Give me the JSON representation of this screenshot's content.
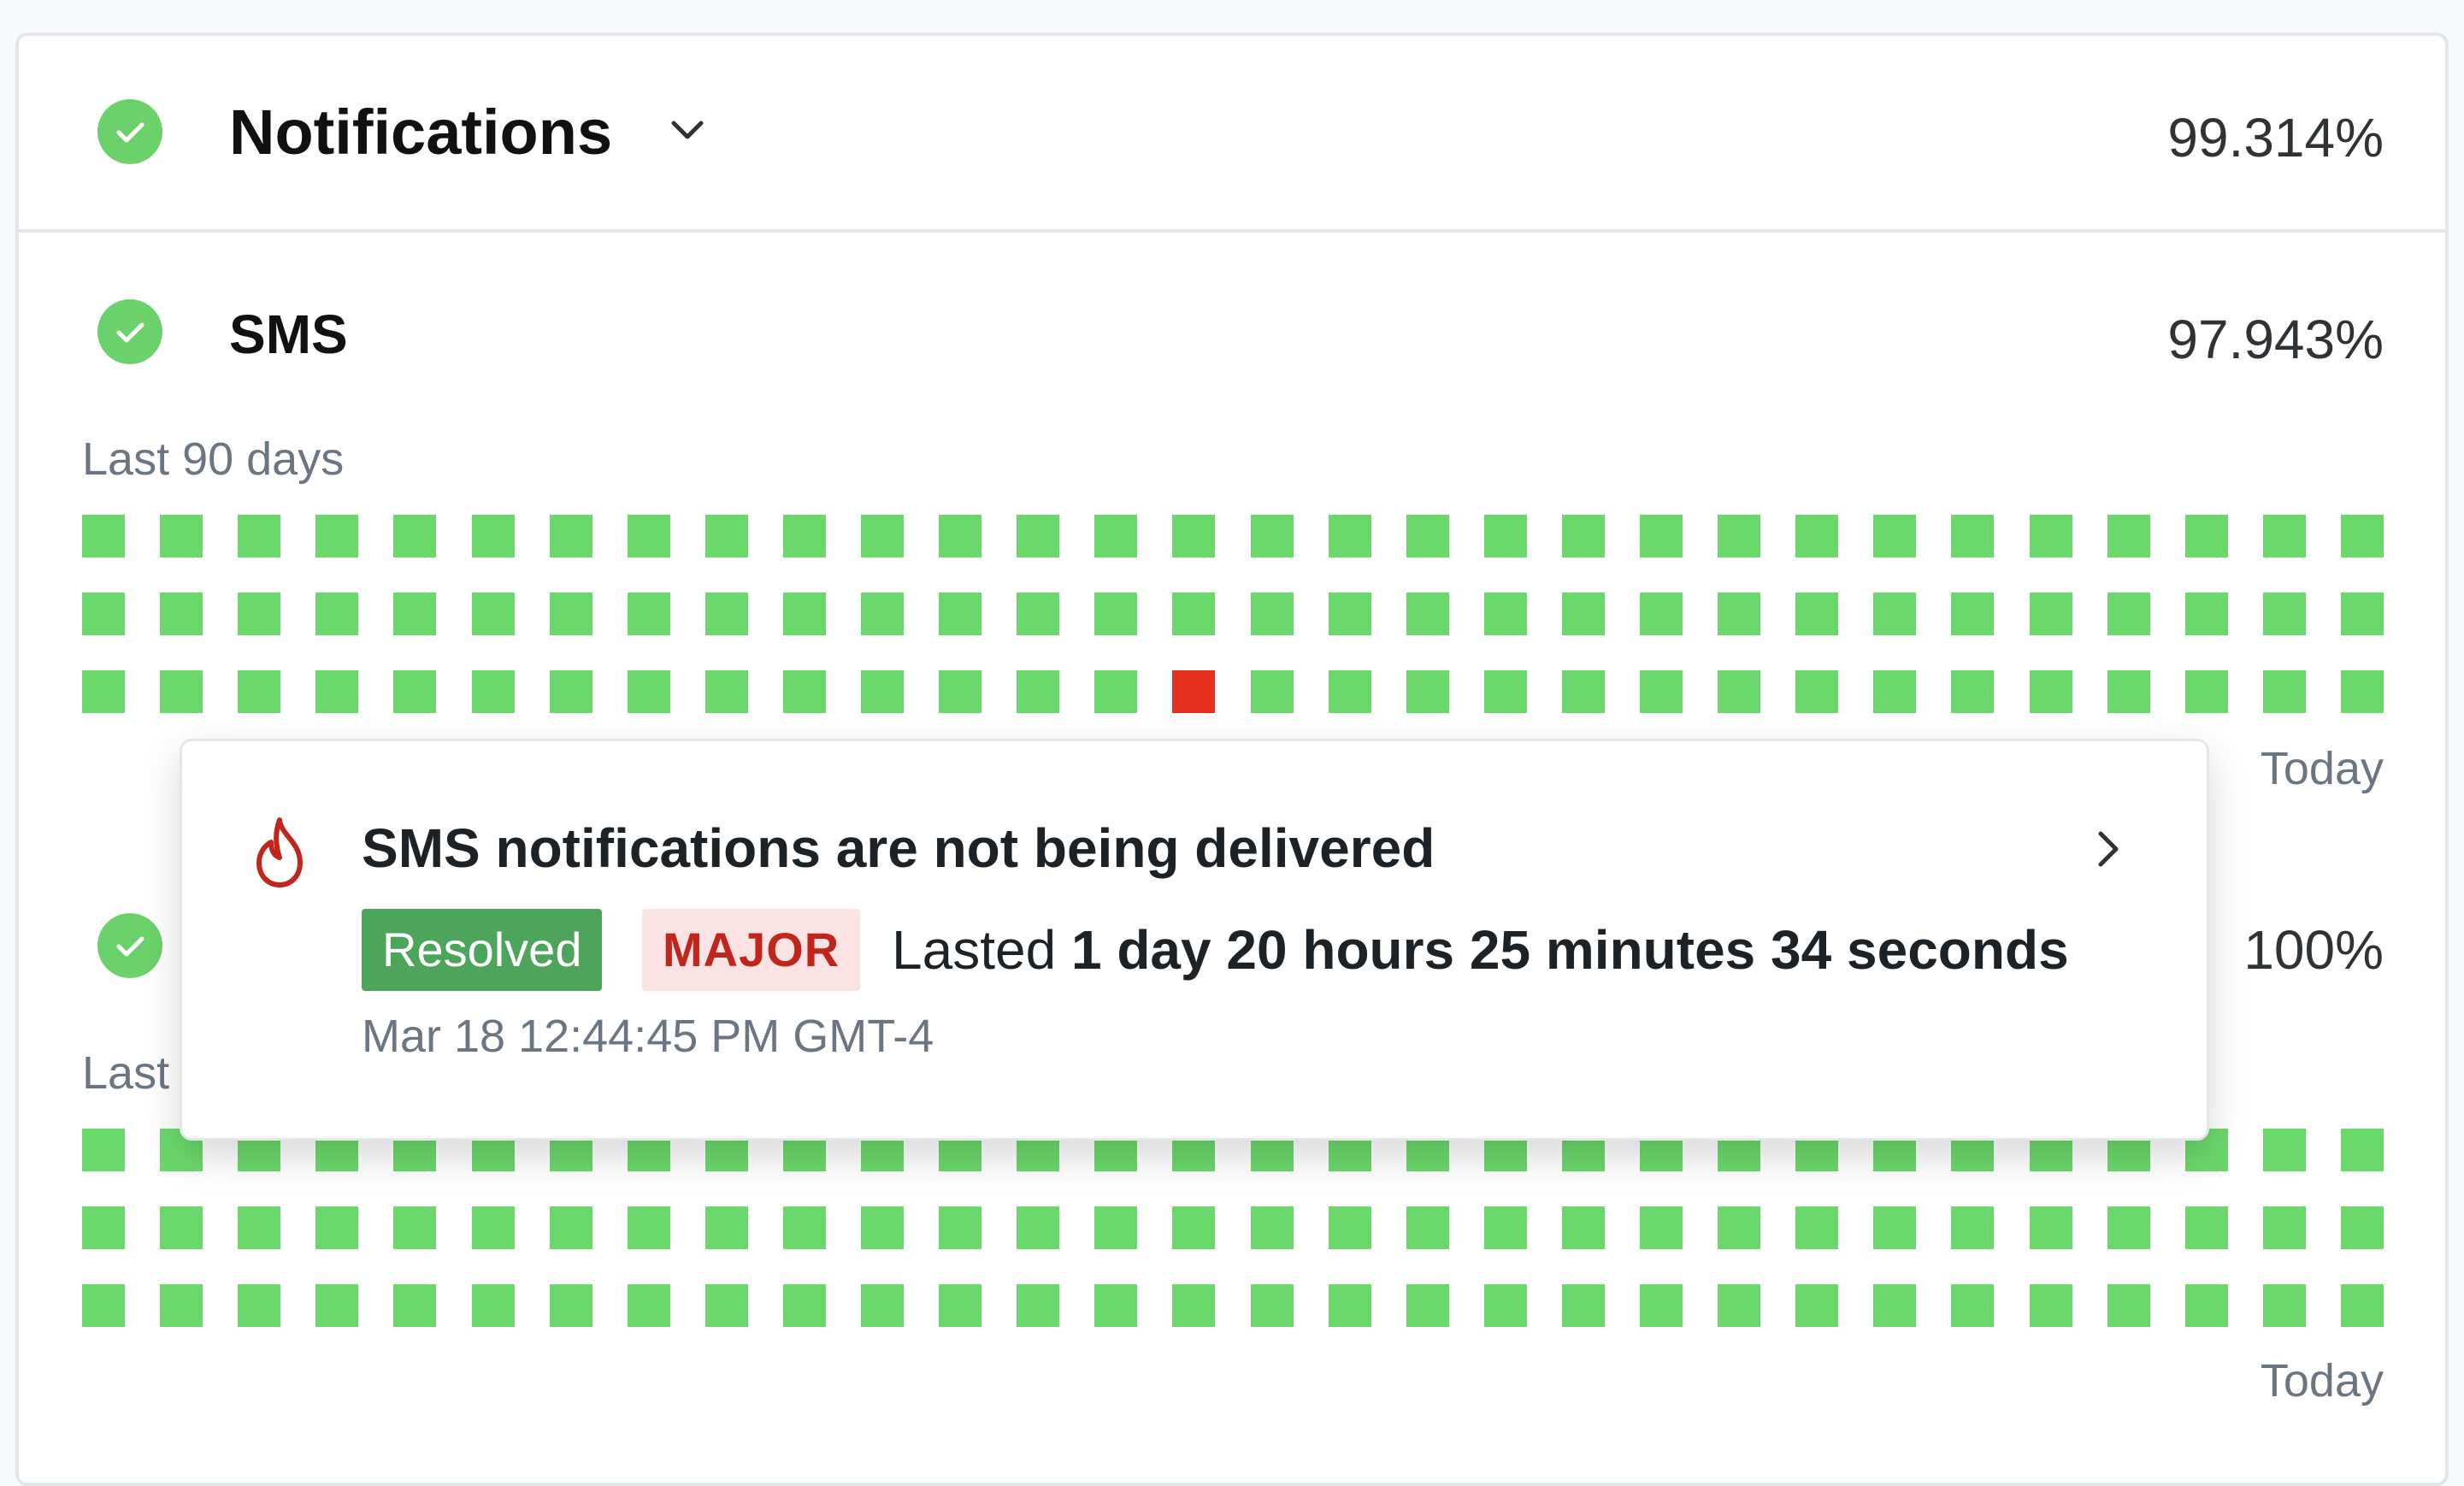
{
  "notifications": {
    "title": "Notifications",
    "uptime": "99.314%"
  },
  "sms": {
    "title": "SMS",
    "uptime": "97.943%",
    "range_label": "Last 90 days",
    "today_label": "Today",
    "days_total": 90,
    "incident_day_index": 74,
    "colors": {
      "ok": "#6bd86b",
      "major": "#e3301f"
    }
  },
  "second_service": {
    "uptime": "100%",
    "range_label_visible": "Last",
    "today_label": "Today",
    "days_total": 90
  },
  "tooltip": {
    "title": "SMS notifications are not being delivered",
    "status": "Resolved",
    "severity": "MAJOR",
    "lasted_prefix": "Lasted",
    "duration": "1 day 20 hours 25 minutes 34 seconds",
    "date": "Mar 18 12:44:45 PM GMT-4",
    "icon": "flame-icon"
  },
  "colors": {
    "accent_green": "#6bd26b",
    "resolved_bg": "#4ca55b",
    "major_text": "#c0261c",
    "major_bg": "#fbe3e3"
  }
}
